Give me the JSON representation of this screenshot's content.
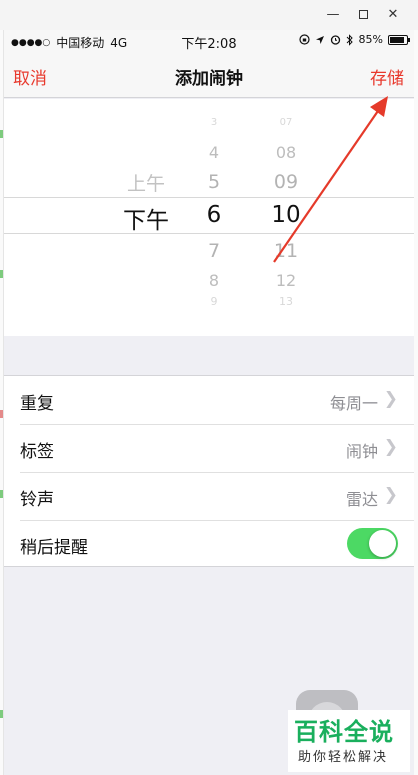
{
  "window": {
    "minimize_glyph": "—",
    "close_glyph": "✕"
  },
  "status_bar": {
    "signal": "●●●●○",
    "carrier": "中国移动",
    "network": "4G",
    "time": "下午2:08",
    "icons": [
      "orientation-lock-icon",
      "location-icon",
      "alarm-icon",
      "bluetooth-icon"
    ],
    "battery_percent": "85%",
    "battery_level": 0.85
  },
  "nav": {
    "cancel": "取消",
    "title": "添加闹钟",
    "save": "存储",
    "accent_color": "#e8392d"
  },
  "picker": {
    "ampm": {
      "above": "上午",
      "selected": "下午"
    },
    "hours": {
      "above": [
        "3",
        "4",
        "5"
      ],
      "selected": "6",
      "below": [
        "7",
        "8",
        "9"
      ]
    },
    "minutes": {
      "above": [
        "07",
        "08",
        "09"
      ],
      "selected": "10",
      "below": [
        "11",
        "12",
        "13"
      ]
    }
  },
  "settings": [
    {
      "label": "重复",
      "value": "每周一"
    },
    {
      "label": "标签",
      "value": "闹钟"
    },
    {
      "label": "铃声",
      "value": "雷达"
    },
    {
      "label": "稍后提醒",
      "toggle": true,
      "toggle_color": "#4cd964"
    }
  ],
  "watermark": {
    "title": "百科全说",
    "subtitle": "助你轻松解决"
  }
}
